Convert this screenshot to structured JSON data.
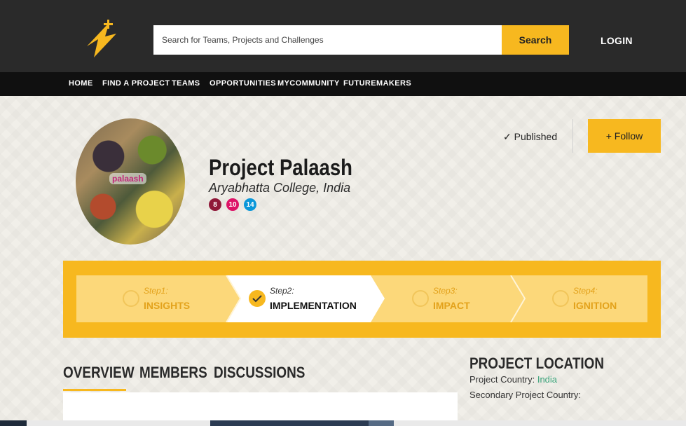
{
  "header": {
    "search_placeholder": "Search for Teams, Projects and Challenges",
    "search_button": "Search",
    "login": "LOGIN",
    "brand_color": "#f7b81f"
  },
  "nav": [
    "HOME",
    "FIND A PROJECT",
    "TEAMS",
    "OPPORTUNITIES",
    "MYCOMMUNITY",
    "FUTUREMAKERS"
  ],
  "project": {
    "title": "Project Palaash",
    "subtitle": "Aryabhatta College, India",
    "avatar_text": "palaash",
    "sdg_badges": [
      {
        "number": "8",
        "color": "#8f1838"
      },
      {
        "number": "10",
        "color": "#dd1367"
      },
      {
        "number": "14",
        "color": "#0a97d9"
      }
    ],
    "status": "✓ Published",
    "follow_button": "+ Follow"
  },
  "steps": [
    {
      "num": "Step1:",
      "name": "INSIGHTS",
      "active": false
    },
    {
      "num": "Step2:",
      "name": "IMPLEMENTATION",
      "active": true
    },
    {
      "num": "Step3:",
      "name": "IMPACT",
      "active": false
    },
    {
      "num": "Step4:",
      "name": "IGNITION",
      "active": false
    }
  ],
  "tabs": [
    "OVERVIEW",
    "MEMBERS",
    "DISCUSSIONS"
  ],
  "location": {
    "title": "PROJECT LOCATION",
    "country_label": "Project Country:",
    "country_value": "India",
    "secondary_label": "Secondary Project Country:"
  }
}
